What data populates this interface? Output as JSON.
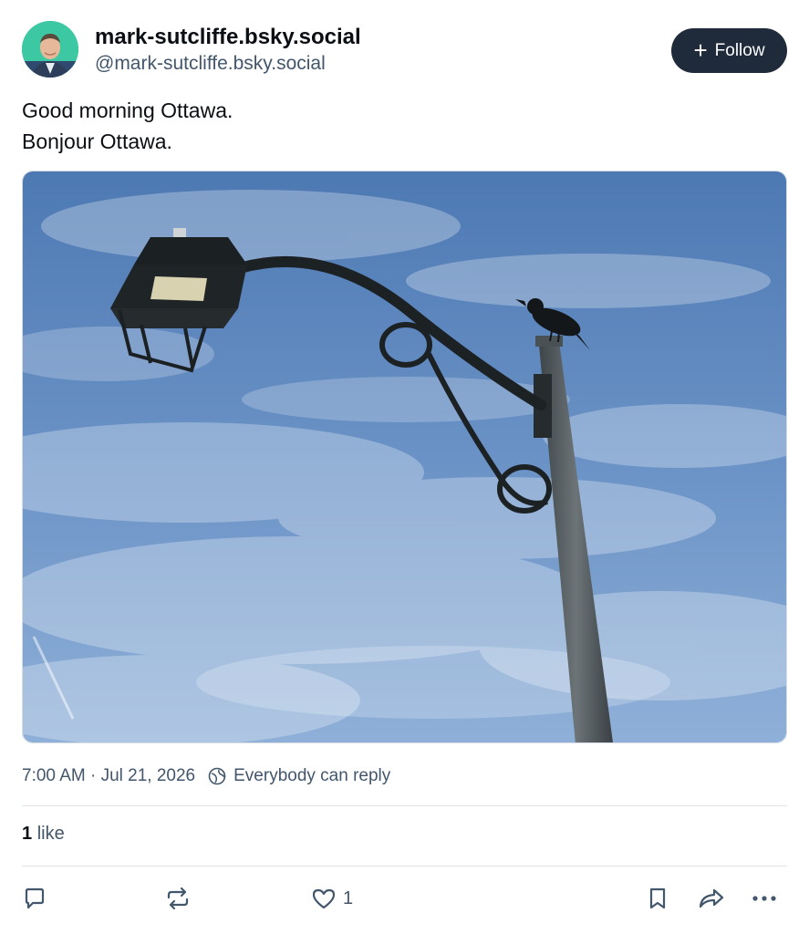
{
  "author": {
    "display_name": "mark-sutcliffe.bsky.social",
    "handle": "@mark-sutcliffe.bsky.social"
  },
  "follow_button": {
    "label": "Follow"
  },
  "post": {
    "lines": [
      "Good morning Ottawa.",
      "Bonjour Ottawa."
    ]
  },
  "meta": {
    "timestamp": "7:00 AM · Jul 21, 2026",
    "reply_setting": "Everybody can reply"
  },
  "stats": {
    "like_count": "1",
    "like_label": "like"
  },
  "actions": {
    "like_count": "1",
    "icons": [
      "reply-icon",
      "repost-icon",
      "heart-icon",
      "bookmark-icon",
      "share-icon",
      "more-icon"
    ]
  },
  "colors": {
    "follow_bg": "#1f2b3b",
    "avatar_bg": "#3cc8a2",
    "muted_text": "#42566c",
    "sky": "#5c86bd"
  }
}
